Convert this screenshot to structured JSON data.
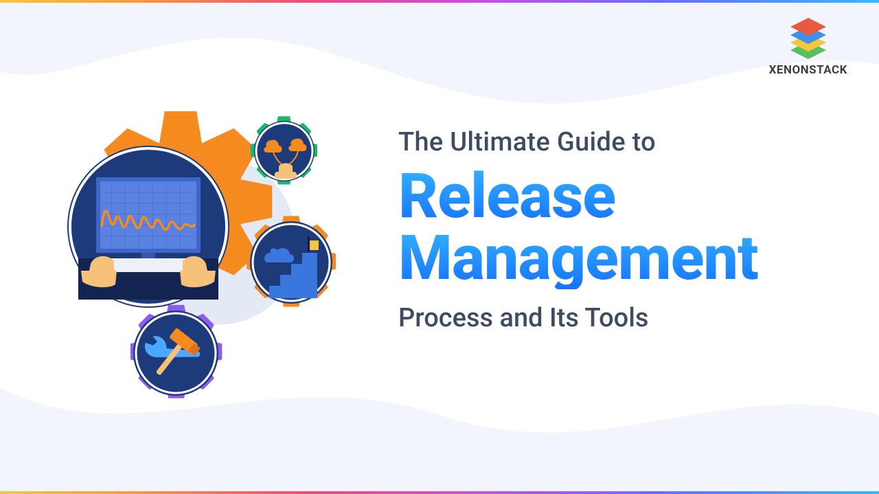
{
  "brand": {
    "name": "XENONSTACK"
  },
  "hero": {
    "line1": "The Ultimate Guide to",
    "line2": "Release",
    "line3": "Management",
    "line4": "Process and Its Tools"
  },
  "colors": {
    "text_dark": "#3e4b60",
    "gradient_top": "#33b2ff",
    "gradient_bottom": "#1671ff",
    "gear_orange": "#f58a1f",
    "gear_green": "#1ab86a",
    "gear_purple": "#8a5cf0",
    "navy": "#233b7a"
  },
  "icons": {
    "logo": "stacked-layers-icon",
    "gear_main": "monitor-waveform-icon",
    "gear_green": "cloud-balloons-icon",
    "gear_orange_small": "stairs-flag-icon",
    "gear_purple": "wrench-hammer-icon"
  }
}
